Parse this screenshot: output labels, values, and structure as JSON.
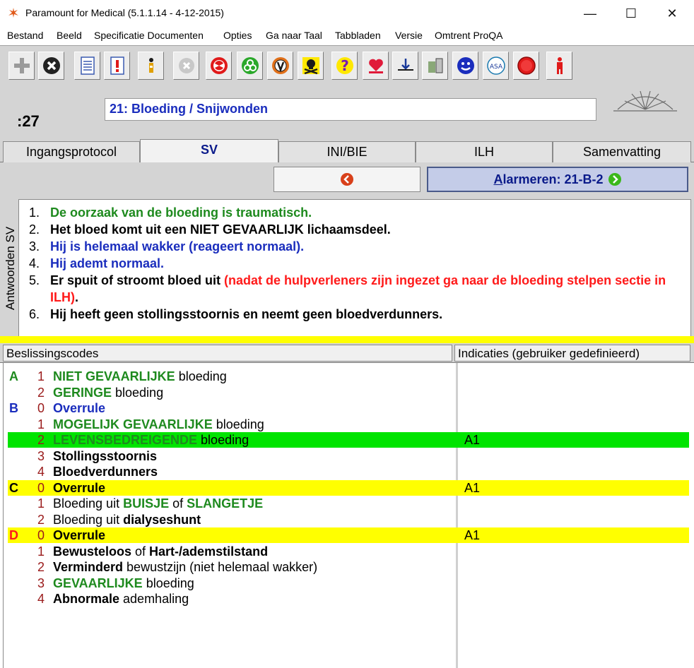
{
  "window": {
    "title": "Paramount for Medical (5.1.1.14 - 4-12-2015)",
    "min": "—",
    "max": "☐",
    "close": "✕"
  },
  "menu": [
    {
      "label": "Bestand"
    },
    {
      "label": "Beeld"
    },
    {
      "label": "Specificatie Documenten"
    },
    {
      "label": "Opties"
    },
    {
      "label": "Ga naar Taal"
    },
    {
      "label": "Tabbladen"
    },
    {
      "label": "Versie"
    },
    {
      "label": "Omtrent ProQA"
    }
  ],
  "toolbar": {
    "buttons": [
      {
        "icon": "plus-icon"
      },
      {
        "icon": "cross-icon"
      },
      {
        "icon": "document-icon"
      },
      {
        "icon": "document-alert-icon"
      },
      {
        "icon": "person-icon"
      },
      {
        "icon": "cancel-icon"
      },
      {
        "icon": "radiation-icon"
      },
      {
        "icon": "biohazard-icon"
      },
      {
        "icon": "v-icon"
      },
      {
        "icon": "skull-icon"
      },
      {
        "icon": "question-icon"
      },
      {
        "icon": "heart-icon"
      },
      {
        "icon": "down-arrow-icon"
      },
      {
        "icon": "tools-icon"
      },
      {
        "icon": "face-icon"
      },
      {
        "icon": "asa-icon",
        "text": "ASA"
      },
      {
        "icon": "stop-icon"
      },
      {
        "icon": "figure-icon"
      }
    ]
  },
  "counter": ":27",
  "protocol_title": "21:  Bloeding / Snijwonden",
  "tabs": [
    {
      "label": "Ingangsprotocol",
      "active": false
    },
    {
      "label": "SV",
      "active": true
    },
    {
      "label": "INI/BIE",
      "active": false
    },
    {
      "label": "ILH",
      "active": false
    },
    {
      "label": "Samenvatting",
      "active": false
    }
  ],
  "alarm_button": {
    "prefix": "A",
    "label": "larmeren: 21-B-2"
  },
  "answers_label": "Antwoorden SV",
  "answers": [
    {
      "num": "1.",
      "parts": [
        {
          "text": "De oorzaak van de bloeding is traumatisch.",
          "color": "green"
        }
      ]
    },
    {
      "num": "2.",
      "parts": [
        {
          "text": "Het bloed komt uit een NIET GEVAARLIJK lichaamsdeel.",
          "color": "black"
        }
      ]
    },
    {
      "num": "3.",
      "parts": [
        {
          "text": "Hij is helemaal wakker (reageert normaal).",
          "color": "blue"
        }
      ]
    },
    {
      "num": "4.",
      "parts": [
        {
          "text": "Hij ademt normaal.",
          "color": "blue"
        }
      ]
    },
    {
      "num": "5.",
      "parts": [
        {
          "text": "Er spuit of stroomt bloed uit ",
          "color": "black"
        },
        {
          "text": "(nadat de hulpverleners zijn ingezet ga naar de bloeding stelpen sectie in ILH)",
          "color": "red"
        },
        {
          "text": ".",
          "color": "black"
        }
      ]
    },
    {
      "num": "6.",
      "parts": [
        {
          "text": "Hij heeft geen stollingsstoornis en neemt geen bloedverdunners.",
          "color": "black"
        }
      ]
    }
  ],
  "codes_header": "Beslissingscodes",
  "indications_header": "Indicaties (gebruiker gedefinieerd)",
  "codes": [
    {
      "level": "A",
      "n": "1",
      "hl": "",
      "ind": "",
      "parts": [
        {
          "t": "NIET GEVAARLIJKE",
          "s": "g"
        },
        {
          "t": " bloeding",
          "s": ""
        }
      ]
    },
    {
      "level": "",
      "n": "2",
      "hl": "",
      "ind": "",
      "parts": [
        {
          "t": "GERINGE",
          "s": "g"
        },
        {
          "t": " bloeding",
          "s": ""
        }
      ]
    },
    {
      "level": "B",
      "n": "0",
      "hl": "",
      "ind": "",
      "parts": [
        {
          "t": "Overrule",
          "s": "bb"
        }
      ]
    },
    {
      "level": "",
      "n": "1",
      "hl": "",
      "ind": "",
      "parts": [
        {
          "t": "MOGELIJK GEVAARLIJKE",
          "s": "g"
        },
        {
          "t": " bloeding",
          "s": ""
        }
      ]
    },
    {
      "level": "",
      "n": "2",
      "hl": "green",
      "ind": "A1",
      "parts": [
        {
          "t": "LEVENSBEDREIGENDE",
          "s": "g"
        },
        {
          "t": " bloeding",
          "s": ""
        }
      ]
    },
    {
      "level": "",
      "n": "3",
      "hl": "",
      "ind": "",
      "parts": [
        {
          "t": "Stollingsstoornis",
          "s": "b"
        }
      ]
    },
    {
      "level": "",
      "n": "4",
      "hl": "",
      "ind": "",
      "parts": [
        {
          "t": "Bloedverdunners",
          "s": "b"
        }
      ]
    },
    {
      "level": "C",
      "n": "0",
      "hl": "yellow",
      "ind": "A1",
      "parts": [
        {
          "t": "Overrule",
          "s": "b"
        }
      ]
    },
    {
      "level": "",
      "n": "1",
      "hl": "",
      "ind": "",
      "parts": [
        {
          "t": "Bloeding uit ",
          "s": ""
        },
        {
          "t": "BUISJE",
          "s": "g"
        },
        {
          "t": " of ",
          "s": ""
        },
        {
          "t": "SLANGETJE",
          "s": "g"
        }
      ]
    },
    {
      "level": "",
      "n": "2",
      "hl": "",
      "ind": "",
      "parts": [
        {
          "t": "Bloeding uit ",
          "s": ""
        },
        {
          "t": "dialyseshunt",
          "s": "b"
        }
      ]
    },
    {
      "level": "D",
      "n": "0",
      "hl": "yellow",
      "ind": "A1",
      "parts": [
        {
          "t": "Overrule",
          "s": "b"
        }
      ]
    },
    {
      "level": "",
      "n": "1",
      "hl": "",
      "ind": "",
      "parts": [
        {
          "t": "Bewusteloos",
          "s": "b"
        },
        {
          "t": " of ",
          "s": ""
        },
        {
          "t": "Hart-/ademstilstand",
          "s": "b"
        }
      ]
    },
    {
      "level": "",
      "n": "2",
      "hl": "",
      "ind": "",
      "parts": [
        {
          "t": "Verminderd",
          "s": "b"
        },
        {
          "t": " bewustzijn (niet helemaal wakker)",
          "s": ""
        }
      ]
    },
    {
      "level": "",
      "n": "3",
      "hl": "",
      "ind": "",
      "parts": [
        {
          "t": "GEVAARLIJKE",
          "s": "g"
        },
        {
          "t": " bloeding",
          "s": ""
        }
      ]
    },
    {
      "level": "",
      "n": "4",
      "hl": "",
      "ind": "",
      "parts": [
        {
          "t": "Abnormale",
          "s": "b"
        },
        {
          "t": " ademhaling",
          "s": ""
        }
      ]
    }
  ]
}
